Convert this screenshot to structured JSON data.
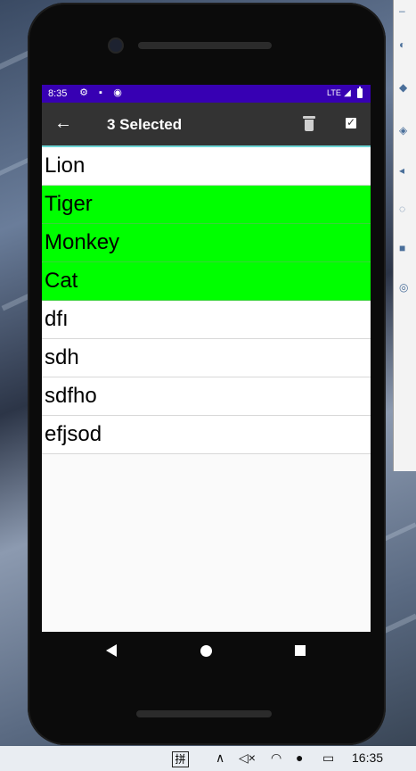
{
  "status_bar": {
    "time": "8:35",
    "icons": [
      "gear-icon",
      "sd-card-icon",
      "sync-icon"
    ],
    "network": "LTE",
    "signal": "signal-icon",
    "battery": "battery-icon"
  },
  "toolbar": {
    "back_icon": "←",
    "title": "3 Selected",
    "delete_icon": "trash-icon",
    "select_all_icon": "checkbox-icon",
    "background": "#333333"
  },
  "list": {
    "items": [
      {
        "label": "Lion",
        "selected": false
      },
      {
        "label": "Tiger",
        "selected": true
      },
      {
        "label": "Monkey",
        "selected": true
      },
      {
        "label": "Cat",
        "selected": true
      },
      {
        "label": "dfı",
        "selected": false
      },
      {
        "label": "sdh",
        "selected": false
      },
      {
        "label": "sdfho",
        "selected": false
      },
      {
        "label": "efjsod",
        "selected": false
      }
    ],
    "selected_color": "#00ff00"
  },
  "nav_bar": {
    "back": "nav-back-icon",
    "home": "nav-home-icon",
    "recents": "nav-recents-icon"
  },
  "taskbar": {
    "ime": "拼",
    "time": "16:35"
  },
  "colors": {
    "status_bar": "#3700b3",
    "toolbar_accent": "#6ed6d6"
  }
}
